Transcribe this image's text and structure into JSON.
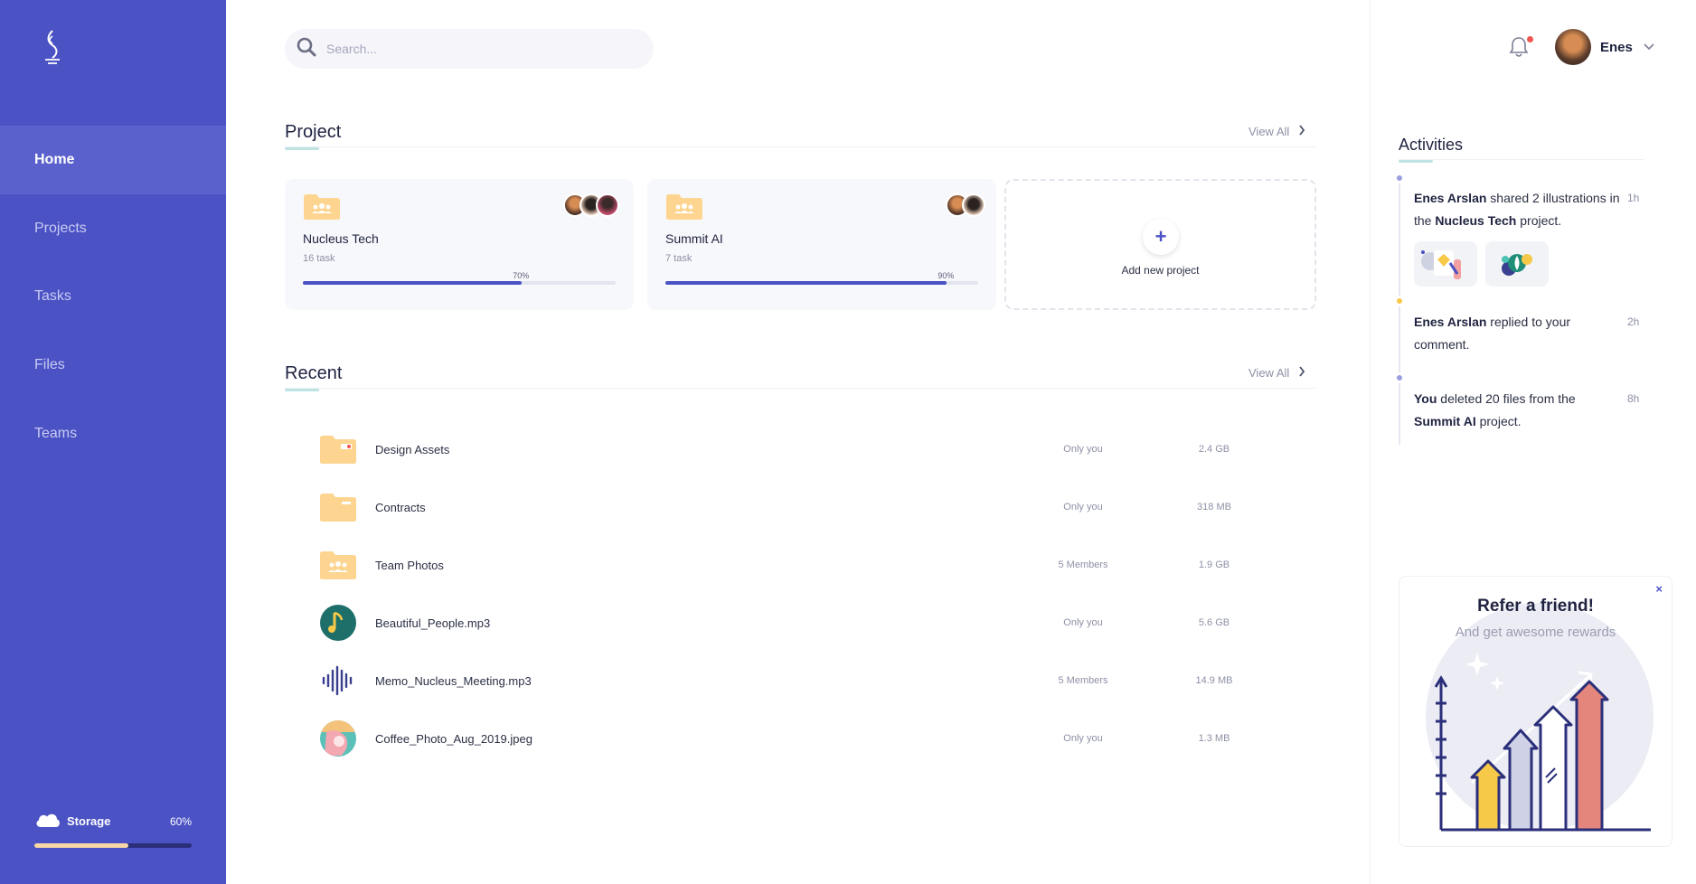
{
  "sidebar": {
    "logo": "logo-icon",
    "items": [
      {
        "label": "Home",
        "active": true
      },
      {
        "label": "Projects",
        "active": false
      },
      {
        "label": "Tasks",
        "active": false
      },
      {
        "label": "Files",
        "active": false
      },
      {
        "label": "Teams",
        "active": false
      }
    ],
    "storage": {
      "label": "Storage",
      "percent_label": "60%",
      "percent": 60
    }
  },
  "search": {
    "placeholder": "Search..."
  },
  "projects_section": {
    "title": "Project",
    "view_all": "View All",
    "cards": [
      {
        "name": "Nucleus Tech",
        "tasks": "16 task",
        "progress_label": "70%",
        "progress": 70
      },
      {
        "name": "Summit AI",
        "tasks": "7 task",
        "progress_label": "90%",
        "progress": 90
      }
    ],
    "add_label": "Add new project"
  },
  "recent_section": {
    "title": "Recent",
    "view_all": "View All",
    "files": [
      {
        "name": "Design Assets",
        "access": "Only you",
        "size": "2.4 GB",
        "icon": "folder-icon"
      },
      {
        "name": "Contracts",
        "access": "Only you",
        "size": "318 MB",
        "icon": "folder-icon"
      },
      {
        "name": "Team Photos",
        "access": "5 Members",
        "size": "1.9 GB",
        "icon": "team-folder-icon"
      },
      {
        "name": "Beautiful_People.mp3",
        "access": "Only you",
        "size": "5.6 GB",
        "icon": "music-icon"
      },
      {
        "name": "Memo_Nucleus_Meeting.mp3",
        "access": "5 Members",
        "size": "14.9 MB",
        "icon": "audio-wave-icon"
      },
      {
        "name": "Coffee_Photo_Aug_2019.jpeg",
        "access": "Only you",
        "size": "1.3 MB",
        "icon": "photo-icon"
      }
    ]
  },
  "header": {
    "user_name": "Enes"
  },
  "activities": {
    "title": "Activities",
    "items": [
      {
        "actor": "Enes Arslan",
        "text1": " shared 2 illustrations in the ",
        "target": "Nucleus Tech",
        "text2": " project.",
        "time": "1h"
      },
      {
        "actor": "Enes Arslan",
        "text1": " replied to your comment.",
        "time": "2h"
      },
      {
        "actor": "You",
        "text1": " deleted 20 files from the ",
        "target": "Summit AI",
        "text2": " project.",
        "time": "8h"
      }
    ]
  },
  "refer": {
    "title": "Refer a friend!",
    "subtitle": "And get awesome rewards",
    "close": "×"
  },
  "colors": {
    "sidebar": "#4b52c4",
    "accent": "#4b52c4",
    "folder": "#fdd590"
  }
}
